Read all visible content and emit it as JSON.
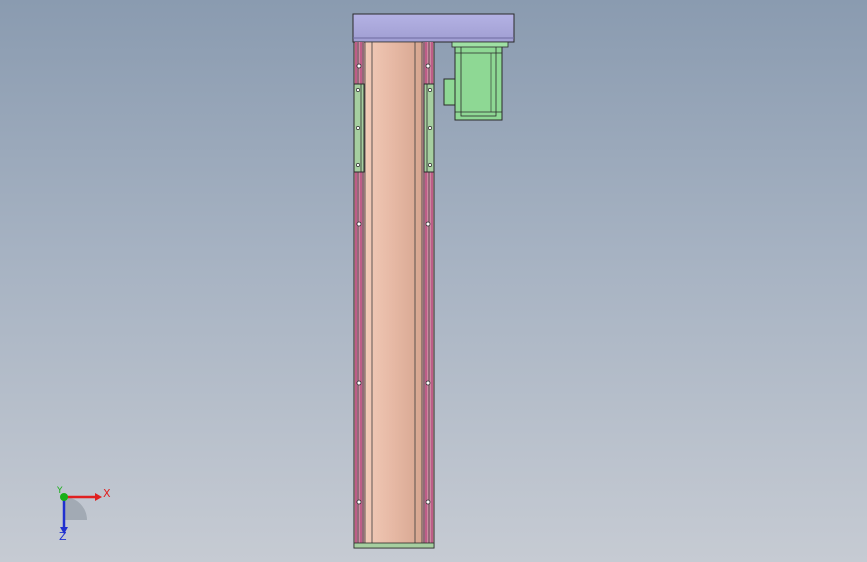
{
  "window": {
    "background_top": "#8a9bb0",
    "background_bottom": "#c6cbd3"
  },
  "model": {
    "top_plate_color": "#aaa8dc",
    "body_color": "#e8bba8",
    "rail_color": "#a6cfa0",
    "edge_color": "#c0457a",
    "motor_color": "#8ed894",
    "outline_color": "#2a2a2a"
  },
  "triad": {
    "x_label": "X",
    "y_label": "Y",
    "z_label": "Z",
    "x_color": "#e02020",
    "y_color": "#18b018",
    "z_color": "#2030d0"
  }
}
